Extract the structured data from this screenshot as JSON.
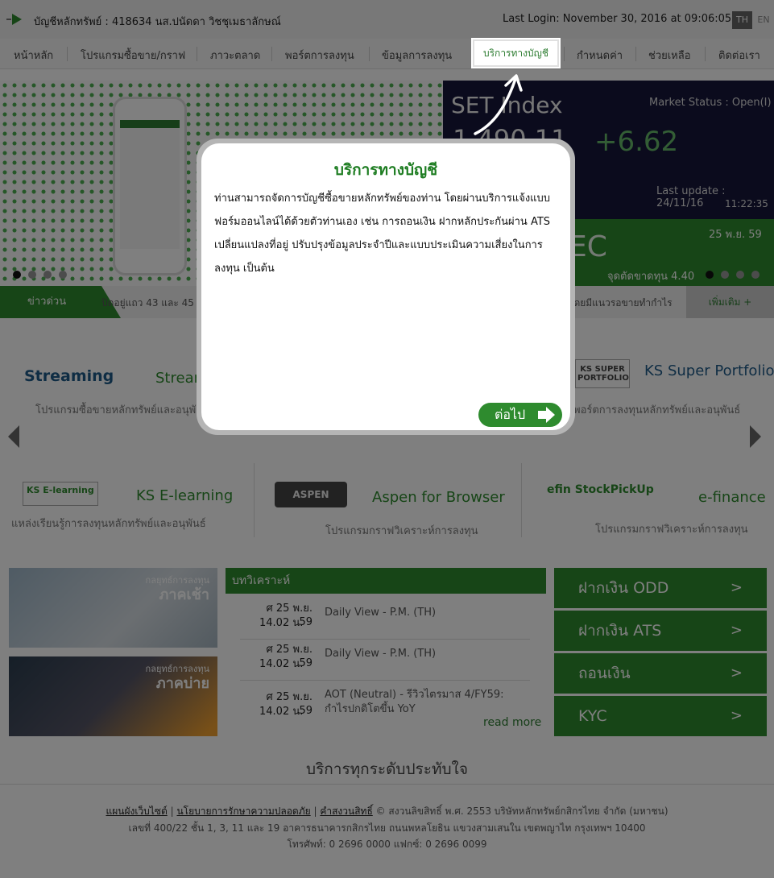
{
  "topbar": {
    "account": "บัญชีหลักทรัพย์ : 418634 นส.ปนัดดา วิชชุเมธาลักษณ์",
    "last_login": "Last Login: November 30, 2016 at 09:06:05",
    "lang_th": "TH",
    "lang_en": "EN"
  },
  "nav": {
    "items": [
      "หน้าหลัก",
      "โปรแกรมซื้อขาย/กราฟ",
      "ภาวะตลาด",
      "พอร์ตการลงทุน",
      "ข้อมูลการลงทุน",
      "บริการทางบัญชี",
      "กำหนดค่า",
      "ช่วยเหลือ",
      "ติดต่อเรา"
    ]
  },
  "banner": {
    "set_title": "SET Index",
    "set_value": "1,490.11",
    "set_change": "+6.62",
    "market_status": "Market Status : Open(I)",
    "last_update": "Last update : 24/11/16",
    "last_update_time": "11:22:35",
    "sec_text": "EC",
    "sec_date": "25 พ.ย. 59",
    "sec_note": "จุดตัดขาดทุน 4.40"
  },
  "news": {
    "label": "ข่าวด่วน",
    "left_text": "ปิดอยู่แถว 43 และ 45",
    "right_text": "โดยมีแนวรอขายทำกำไร",
    "more": "เพิ่มเติม +"
  },
  "products": [
    {
      "logo": "Streaming",
      "name": "Streaming",
      "desc": "โปรแกรมซื้อขายหลักทรัพย์และอนุพันธ์"
    },
    {
      "logo": "KS SUPER PORTFOLIO",
      "name": "KS Super Portfolio",
      "desc": "พอร์ตการลงทุนหลักทรัพย์และอนุพันธ์"
    },
    {
      "logo": "KS E-learning",
      "name": "KS E-learning",
      "desc": "แหล่งเรียนรู้การลงทุนหลักทรัพย์และอนุพันธ์"
    },
    {
      "logo": "ASPEN",
      "name": "Aspen for Browser",
      "desc": "โปรแกรมกราฟวิเคราะห์การลงทุน"
    },
    {
      "logo": "efin StockPickUp",
      "name": "e-finance",
      "desc": "โปรแกรมกราฟวิเคราะห์การลงทุน"
    }
  ],
  "strategy": {
    "morning_small": "กลยุทธ์การลงทุน",
    "morning": "ภาคเช้า",
    "afternoon_small": "กลยุทธ์การลงทุน",
    "afternoon": "ภาคบ่าย"
  },
  "analysis": {
    "header": "บทวิเคราะห์",
    "rows": [
      {
        "date": "ศ 25 พ.ย. 59",
        "time": "14.02 น.",
        "title": "Daily View - P.M. (TH)"
      },
      {
        "date": "ศ 25 พ.ย. 59",
        "time": "14.02 น.",
        "title": "Daily View - P.M. (TH)"
      },
      {
        "date": "ศ 25 พ.ย. 59",
        "time": "14.02 น.",
        "title": "AOT (Neutral) - รีวิวไตรมาส 4/FY59: กำไรปกติโตขึ้น YoY"
      }
    ],
    "read_more": "read more"
  },
  "side_buttons": [
    {
      "label": "ฝากเงิน ODD",
      "chev": ">"
    },
    {
      "label": "ฝากเงิน ATS",
      "chev": ">"
    },
    {
      "label": "ถอนเงิน",
      "chev": ">"
    },
    {
      "label": "KYC",
      "chev": ">"
    }
  ],
  "tagline": "บริการทุกระดับประทับใจ",
  "footer": {
    "sitemap": "แผนผังเว็บไซต์",
    "privacy": "นโยบายการรักษาความปลอดภัย",
    "disclaimer": "คำสงวนสิทธิ์",
    "copyright": "© สงวนลิขสิทธิ์ พ.ศ. 2553 บริษัทหลักทรัพย์กสิกรไทย จำกัด (มหาชน)",
    "address": "เลขที่ 400/22 ชั้น 1, 3, 11 และ 19 อาคารธนาคารกสิกรไทย ถนนพหลโยธิน แขวงสามเสนใน เขตพญาไท กรุงเทพฯ 10400",
    "phone": "โทรศัพท์: 0 2696 0000 แฟกซ์: 0 2696 0099"
  },
  "modal": {
    "title": "บริการทางบัญชี",
    "body": "ท่านสามารถจัดการบัญชีซื้อขายหลักทรัพย์ของท่าน โดยผ่านบริการแจ้งแบบฟอร์มออนไลน์ได้ด้วยตัวท่านเอง เช่น การถอนเงิน ฝากหลักประกันผ่าน ATS เปลี่ยนแปลงที่อยู่ ปรับปรุงข้อมูลประจำปีและแบบประเมินความเสี่ยงในการลงทุน เป็นต้น",
    "next_label": "ต่อไป"
  },
  "colors": {
    "brand_green": "#2e8b2e",
    "title_green": "#1e7d22",
    "overlay": "rgba(0,0,0,0.5)"
  }
}
